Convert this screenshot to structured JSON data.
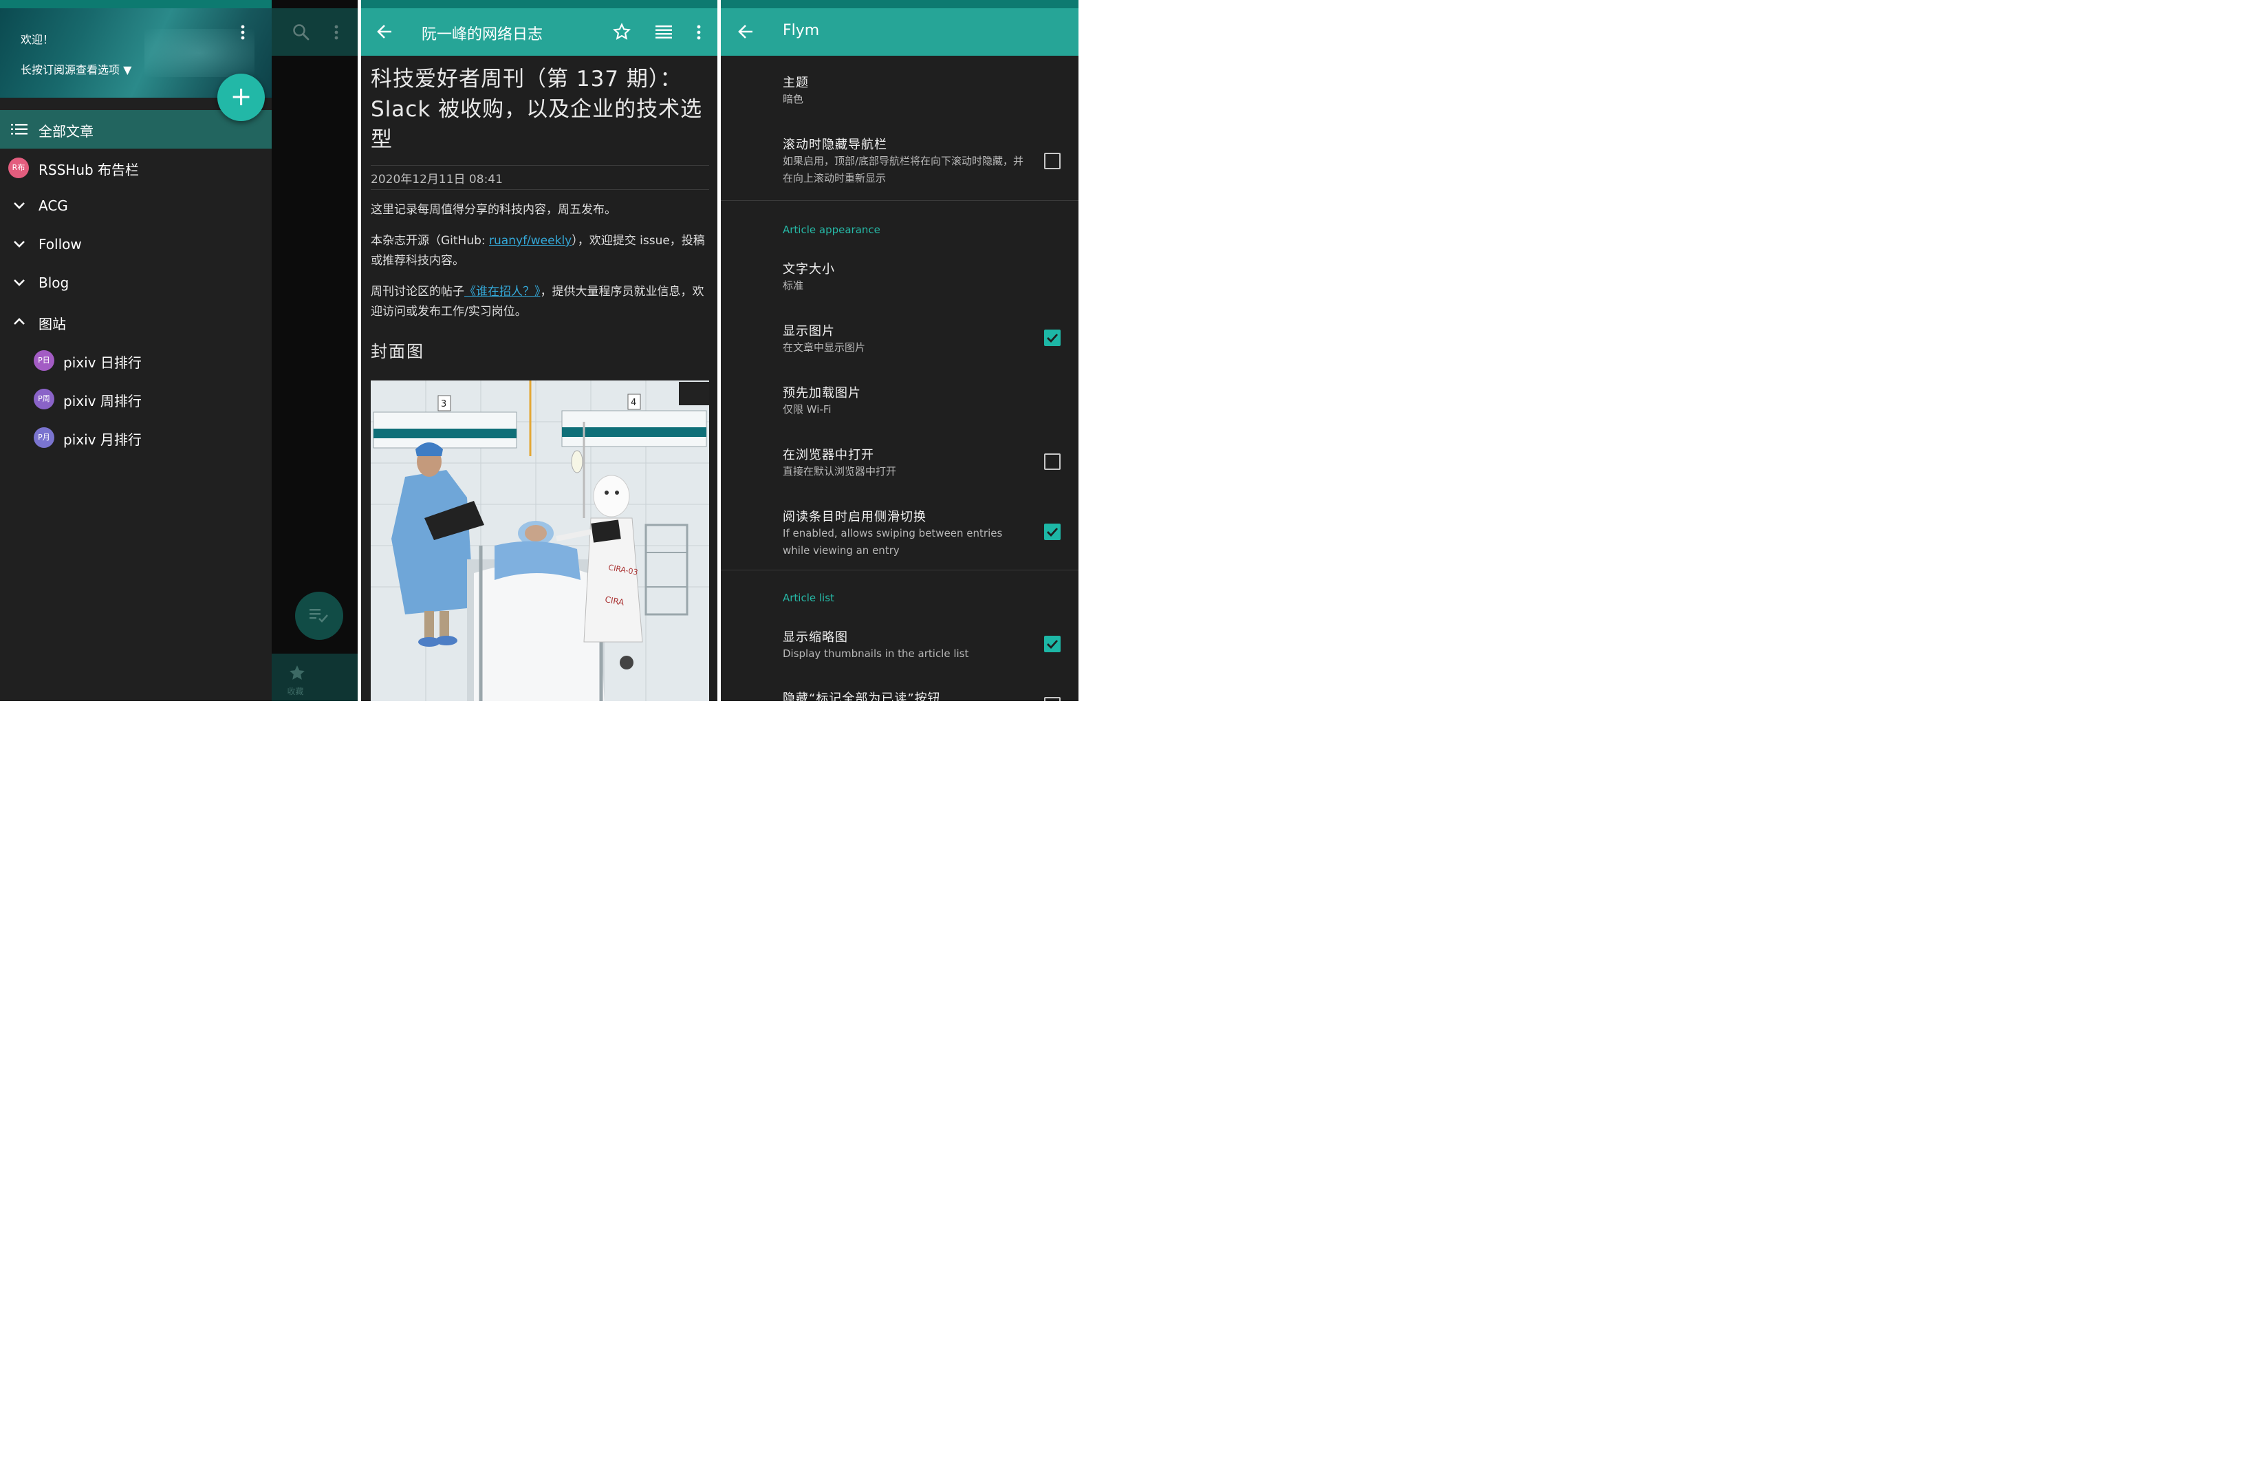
{
  "colors": {
    "accent": "#22b8a7",
    "appbar": "#26a597",
    "statusbar": "#0d7a70",
    "background": "#1f1f1f",
    "link": "#34a9d9"
  },
  "drawer": {
    "welcome": "欢迎！",
    "hint": "长按订阅源查看选项 ▼",
    "add_button": "+",
    "items": [
      {
        "label": "全部文章",
        "icon": "list-icon"
      },
      {
        "label": "RSSHub 布告栏",
        "icon": "feed-avatar",
        "badge": "R布",
        "badge_color": "#e35d7e"
      },
      {
        "label": "ACG",
        "icon": "chevron-down-icon"
      },
      {
        "label": "Follow",
        "icon": "chevron-down-icon"
      },
      {
        "label": "Blog",
        "icon": "chevron-down-icon"
      },
      {
        "label": "图站",
        "icon": "chevron-up-icon"
      },
      {
        "label": "pixiv 日排行",
        "icon": "feed-avatar",
        "badge": "P日",
        "badge_color": "#a35cc4"
      },
      {
        "label": "pixiv 周排行",
        "icon": "feed-avatar",
        "badge": "P周",
        "badge_color": "#8a63c8"
      },
      {
        "label": "pixiv 月排行",
        "icon": "feed-avatar",
        "badge": "P月",
        "badge_color": "#7a74cf"
      }
    ],
    "favorites_label": "收藏"
  },
  "article": {
    "appbar_title": "阮一峰的网络日志",
    "title": "科技爱好者周刊（第 137 期）：Slack 被收购，以及企业的技术选型",
    "date": "2020年12月11日 08:41",
    "p1": "这里记录每周值得分享的科技内容，周五发布。",
    "p2_pre": "本杂志开源（GitHub: ",
    "p2_link": "ruanyf/weekly",
    "p2_post": "），欢迎提交 issue，投稿或推荐科技内容。",
    "p3_pre": "周刊讨论区的帖子",
    "p3_link": "《谁在招人？》",
    "p3_post": "，提供大量程序员就业信息，欢迎访问或发布工作/实习岗位。",
    "h2": "封面图",
    "image_text": {
      "bed3": "3",
      "bed4": "4",
      "robot_badge": "CIRA-03",
      "robot_body": "CIRA"
    }
  },
  "settings": {
    "appbar_title": "Flym",
    "items": [
      {
        "title": "主题",
        "subtitle": "暗色"
      },
      {
        "title": "滚动时隐藏导航栏",
        "subtitle": "如果启用，顶部/底部导航栏将在向下滚动时隐藏，并在向上滚动时重新显示",
        "checked": false
      },
      {
        "title": "文字大小",
        "subtitle": "标准"
      },
      {
        "title": "显示图片",
        "subtitle": "在文章中显示图片",
        "checked": true
      },
      {
        "title": "预先加载图片",
        "subtitle": "仅限 Wi-Fi"
      },
      {
        "title": "在浏览器中打开",
        "subtitle": "直接在默认浏览器中打开",
        "checked": false
      },
      {
        "title": "阅读条目时启用侧滑切换",
        "subtitle": "If enabled, allows swiping between entries while viewing an entry",
        "checked": true
      },
      {
        "title": "显示缩略图",
        "subtitle": "Display thumbnails in the article list",
        "checked": true
      },
      {
        "title": "隐藏“标记全部为已读”按钮",
        "subtitle": ""
      }
    ],
    "sections": [
      "Article appearance",
      "Article list"
    ]
  }
}
